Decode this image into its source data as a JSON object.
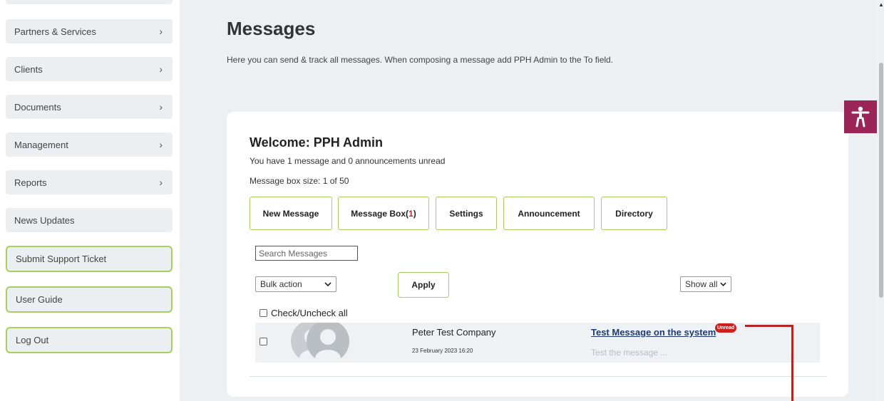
{
  "sidebar": {
    "items": [
      {
        "label": "Partners & Services",
        "chevron": "›"
      },
      {
        "label": "Clients",
        "chevron": "›"
      },
      {
        "label": "Documents",
        "chevron": "›"
      },
      {
        "label": "Management",
        "chevron": "›"
      },
      {
        "label": "Reports",
        "chevron": "›"
      },
      {
        "label": "News Updates"
      }
    ],
    "outlined_items": [
      {
        "label": "Submit Support Ticket"
      },
      {
        "label": "User Guide"
      },
      {
        "label": "Log Out"
      }
    ]
  },
  "page": {
    "title": "Messages",
    "description": "Here you can send & track all messages. When composing a message add PPH Admin to the To field."
  },
  "card": {
    "welcome": "Welcome: PPH Admin",
    "unread_summary": "You have 1 message and 0 announcements unread",
    "box_size": "Message box size: 1 of 50"
  },
  "tabs": {
    "new_message": "New Message",
    "message_box": "Message Box(",
    "message_box_count": "1",
    "message_box_close": ")",
    "settings": "Settings",
    "announcement": "Announcement",
    "directory": "Directory"
  },
  "search": {
    "placeholder": "Search Messages"
  },
  "bulk": {
    "selected": "Bulk action",
    "apply": "Apply"
  },
  "filter": {
    "selected": "Show all"
  },
  "check_all": "Check/Uncheck all",
  "messages": [
    {
      "sender": "Peter Test Company",
      "date": "23 February 2023 16:20",
      "subject": "Test Message on the system",
      "badge": "Unread",
      "preview": "Test the message ..."
    }
  ],
  "colors": {
    "accent_green": "#a8cf5d",
    "accessibility": "#9b2557",
    "unread_red": "#cc1f1f",
    "annotation_red": "#b32626"
  },
  "icons": {
    "accessibility": "accessibility-icon",
    "avatar": "avatar-placeholder-icon",
    "chevron": "chevron-right-icon",
    "dropdown": "chevron-down-icon"
  }
}
